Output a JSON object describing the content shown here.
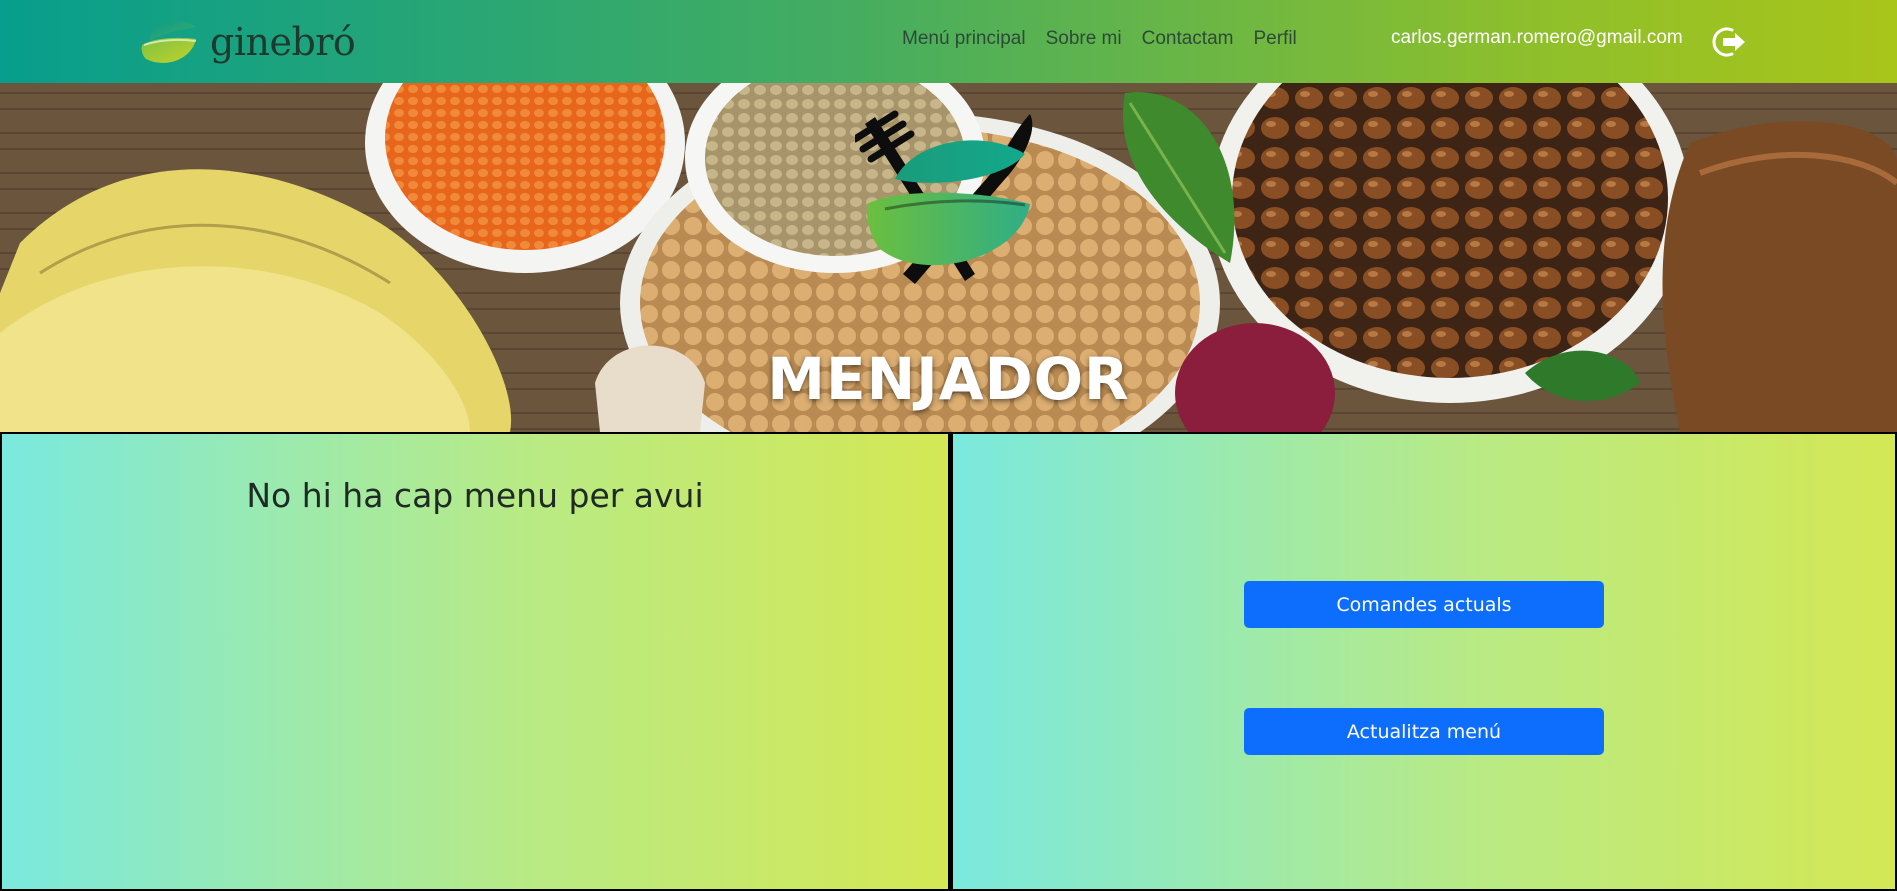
{
  "navbar": {
    "brand": "ginebró",
    "links": [
      {
        "label": "Menú principal"
      },
      {
        "label": "Sobre mi"
      },
      {
        "label": "Contactam"
      },
      {
        "label": "Perfil"
      }
    ],
    "user_email": "carlos.german.romero@gmail.com",
    "logout_icon": "logout-icon"
  },
  "hero": {
    "title": "MENJADOR",
    "icon": "dining-logo-icon"
  },
  "left_panel": {
    "message": "No hi ha cap menu per avui"
  },
  "right_panel": {
    "orders_button": "Comandes actuals",
    "update_button": "Actualitza menú"
  },
  "colors": {
    "primary_button": "#0d6efd",
    "navbar_start": "#079e8d",
    "navbar_end": "#a8c51a",
    "panel_start": "#7ae9de",
    "panel_end": "#d4e854"
  }
}
